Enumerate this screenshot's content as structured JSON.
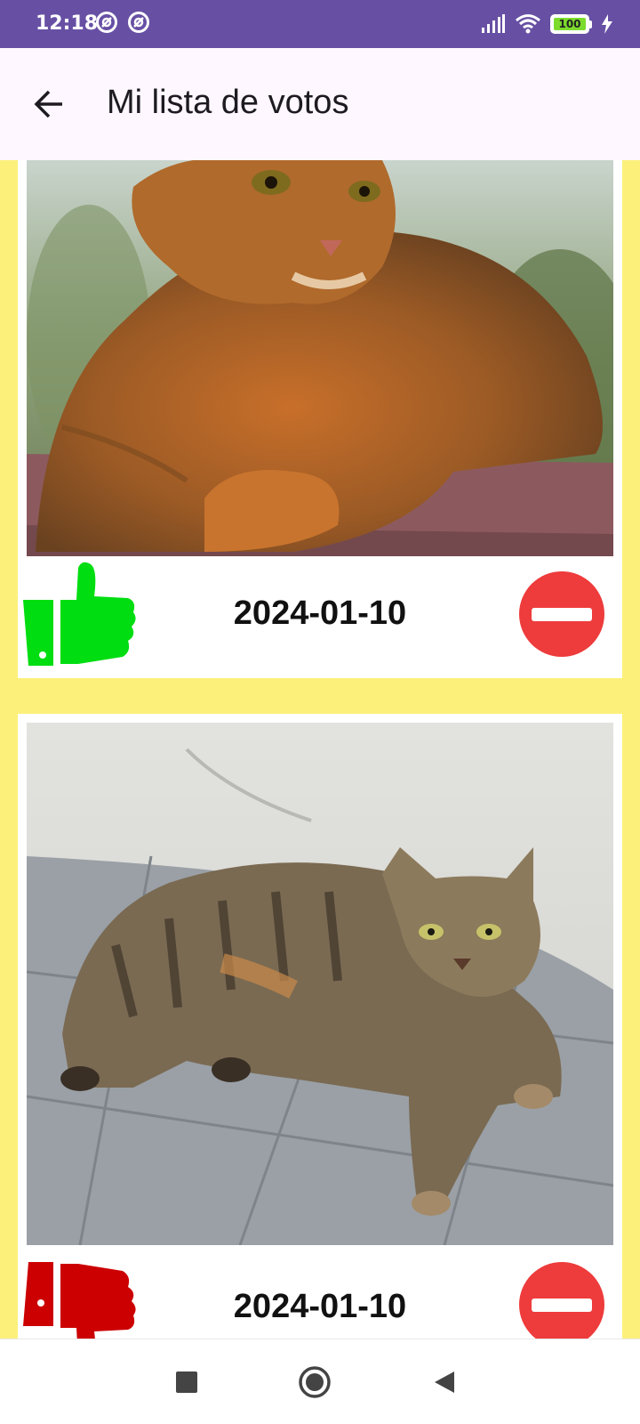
{
  "status_bar": {
    "time": "12:18",
    "battery": "100",
    "icons": [
      "app-notification-icon",
      "app-notification-icon",
      "signal-icon",
      "wifi-icon",
      "battery-icon",
      "charging-icon"
    ]
  },
  "app_bar": {
    "title": "Mi lista de votos",
    "back_icon": "arrow-back-icon"
  },
  "votes": [
    {
      "vote": "like",
      "date": "2024-01-10",
      "image": "ruddy abyssinian cat lying on a reddish stone surface",
      "delete_icon": "remove-circle-icon"
    },
    {
      "vote": "dislike",
      "date": "2024-01-10",
      "image": "striped tabby cat lying on grey paving stones by a white wall",
      "delete_icon": "remove-circle-icon"
    }
  ],
  "nav_bar": {
    "icons": [
      "recents-square-icon",
      "home-circle-icon",
      "back-triangle-icon"
    ]
  },
  "colors": {
    "status_bar": "#6750a4",
    "app_bar": "#fef7ff",
    "background": "#fdf07a",
    "like": "#00dd11",
    "dislike": "#cc0000",
    "delete": "#ee3b3b"
  }
}
